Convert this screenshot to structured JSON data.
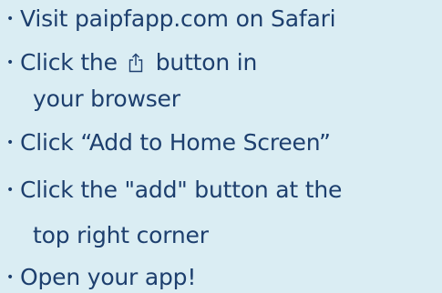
{
  "colors": {
    "background": "#daedf3",
    "text": "#1d3f6e"
  },
  "bullet_glyph": "•",
  "steps": [
    {
      "text": "Visit paipfapp.com on Safari"
    },
    {
      "text_before_icon": "Click the",
      "icon": "share-icon",
      "text_after_icon": "button in",
      "continuation": "your browser"
    },
    {
      "text": "Click “Add to Home Screen”"
    },
    {
      "text": "Click the \"add\" button at the",
      "continuation": "top right corner"
    },
    {
      "text": "Open your app!"
    }
  ]
}
